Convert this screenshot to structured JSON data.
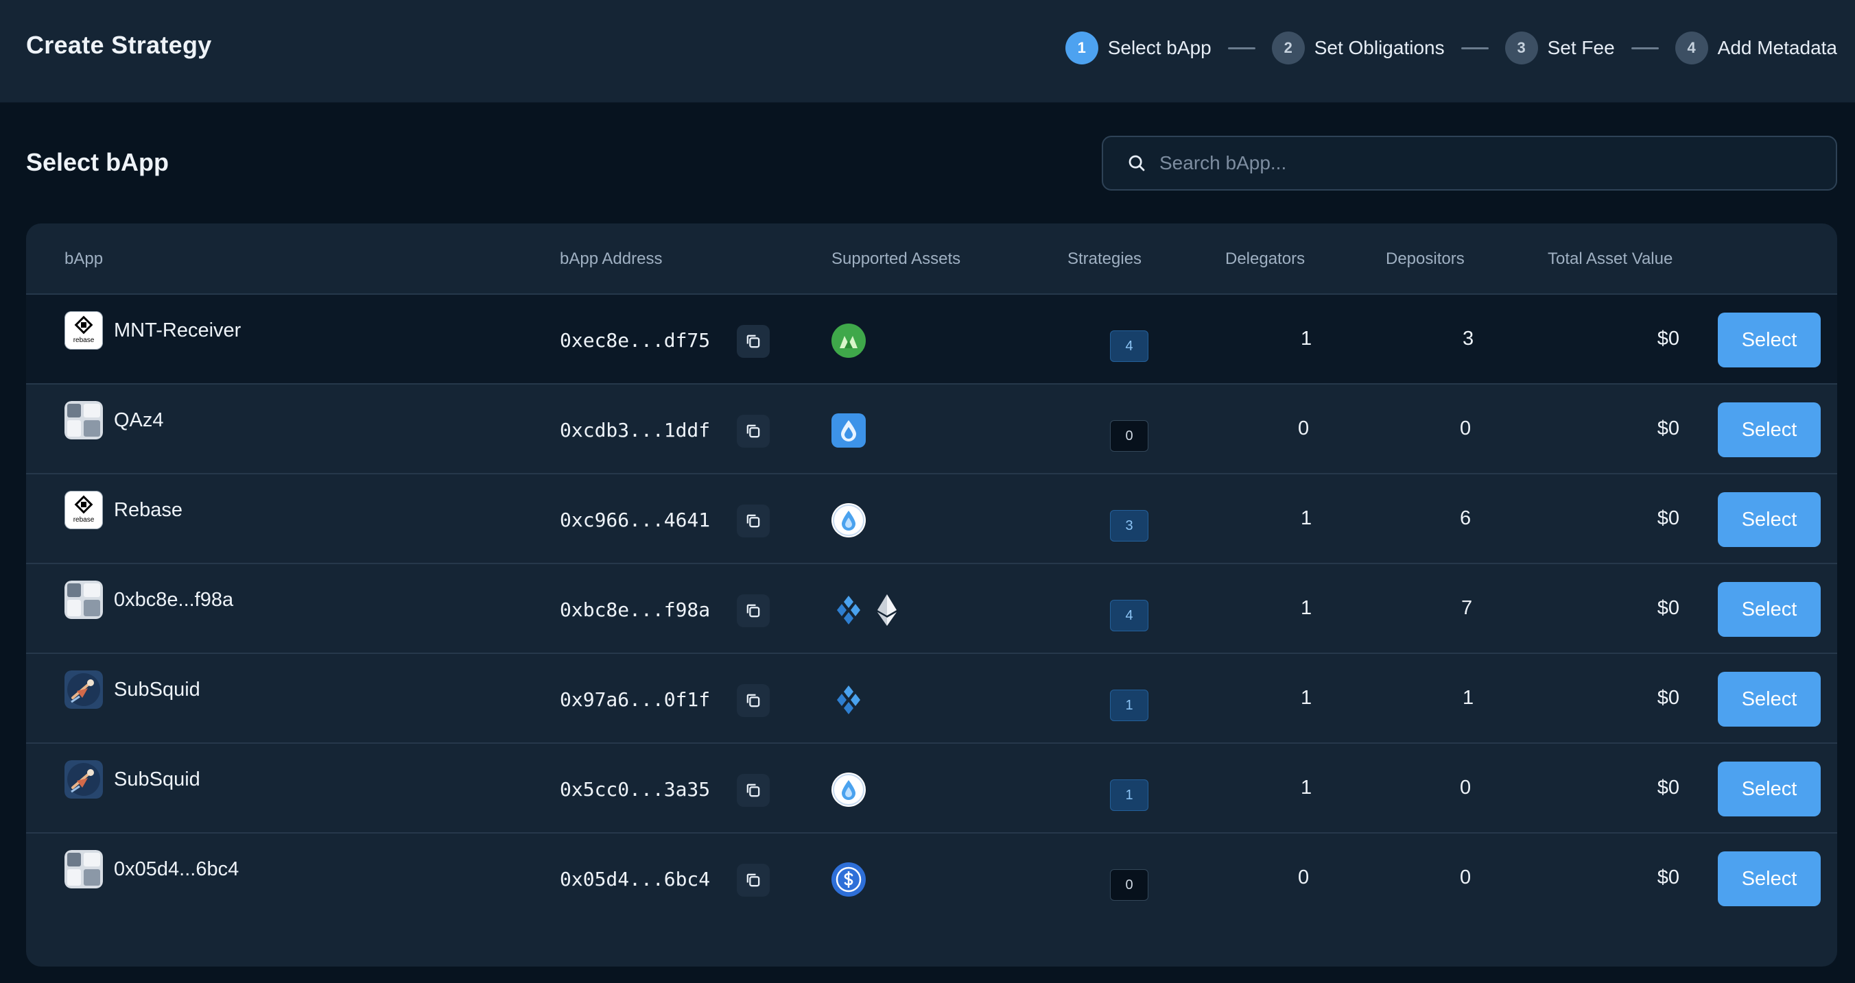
{
  "header": {
    "title": "Create Strategy",
    "steps": [
      {
        "num": "1",
        "label": "Select bApp"
      },
      {
        "num": "2",
        "label": "Set Obligations"
      },
      {
        "num": "3",
        "label": "Set Fee"
      },
      {
        "num": "4",
        "label": "Add Metadata"
      }
    ]
  },
  "section": {
    "title": "Select bApp",
    "search_placeholder": "Search bApp..."
  },
  "table": {
    "columns": [
      "bApp",
      "bApp Address",
      "Supported Assets",
      "Strategies",
      "Delegators",
      "Depositors",
      "Total Asset Value"
    ],
    "rows": [
      {
        "name": "MNT-Receiver",
        "logo": "rebase-logo",
        "address": "0xec8e...df75",
        "assets": [
          "mantle-icon"
        ],
        "strategies": "4",
        "delegators": "1",
        "depositors": "3",
        "tav": "$0",
        "action": "Select"
      },
      {
        "name": "QAz4",
        "logo": "generic-bapp-logo",
        "address": "0xcdb3...1ddf",
        "assets": [
          "ssv-drop-icon"
        ],
        "strategies": "0",
        "delegators": "0",
        "depositors": "0",
        "tav": "$0",
        "action": "Select"
      },
      {
        "name": "Rebase",
        "logo": "rebase-logo",
        "address": "0xc966...4641",
        "assets": [
          "drop-icon"
        ],
        "strategies": "3",
        "delegators": "1",
        "depositors": "6",
        "tav": "$0",
        "action": "Select"
      },
      {
        "name": "0xbc8e...f98a",
        "logo": "generic-bapp-logo",
        "address": "0xbc8e...f98a",
        "assets": [
          "ssv-diamond-icon",
          "ethereum-icon"
        ],
        "strategies": "4",
        "delegators": "1",
        "depositors": "7",
        "tav": "$0",
        "action": "Select"
      },
      {
        "name": "SubSquid",
        "logo": "subsquid-logo",
        "address": "0x97a6...0f1f",
        "assets": [
          "ssv-diamond-icon"
        ],
        "strategies": "1",
        "delegators": "1",
        "depositors": "1",
        "tav": "$0",
        "action": "Select"
      },
      {
        "name": "SubSquid",
        "logo": "subsquid-logo",
        "address": "0x5cc0...3a35",
        "assets": [
          "drop-icon"
        ],
        "strategies": "1",
        "delegators": "1",
        "depositors": "0",
        "tav": "$0",
        "action": "Select"
      },
      {
        "name": "0x05d4...6bc4",
        "logo": "generic-bapp-logo",
        "address": "0x05d4...6bc4",
        "assets": [
          "usdc-icon"
        ],
        "strategies": "0",
        "delegators": "0",
        "depositors": "0",
        "tav": "$0",
        "action": "Select"
      }
    ]
  },
  "colors": {
    "accent": "#4da2f0",
    "background": "#07131f",
    "panel": "#152535"
  }
}
